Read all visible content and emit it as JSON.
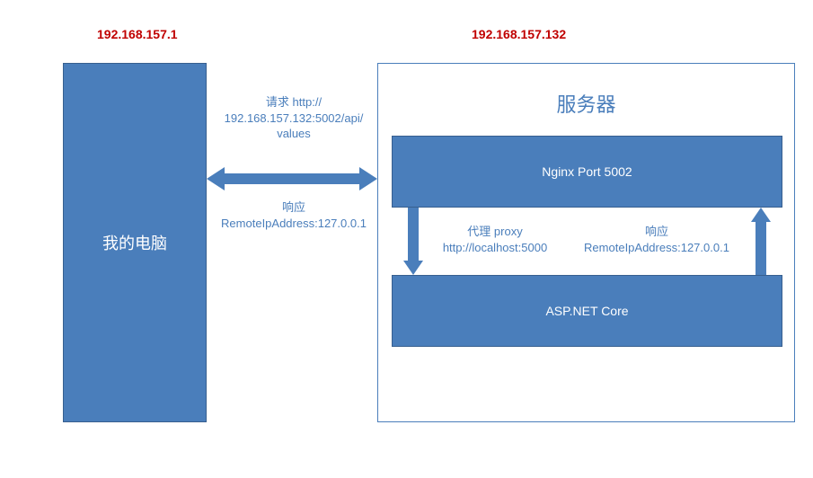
{
  "client": {
    "ip": "192.168.157.1",
    "label": "我的电脑"
  },
  "server": {
    "ip": "192.168.157.132",
    "title": "服务器",
    "nginx_label": "Nginx Port 5002",
    "asp_label": "ASP.NET Core"
  },
  "arrows": {
    "request_line1": "请求 http://",
    "request_line2": "192.168.157.132:5002/api/",
    "request_line3": "values",
    "response_line1": "响应",
    "response_line2": "RemoteIpAddress:127.0.0.1",
    "proxy_line1": "代理 proxy",
    "proxy_line2": "http://localhost:5000",
    "inner_response_line1": "响应",
    "inner_response_line2": "RemoteIpAddress:127.0.0.1"
  }
}
